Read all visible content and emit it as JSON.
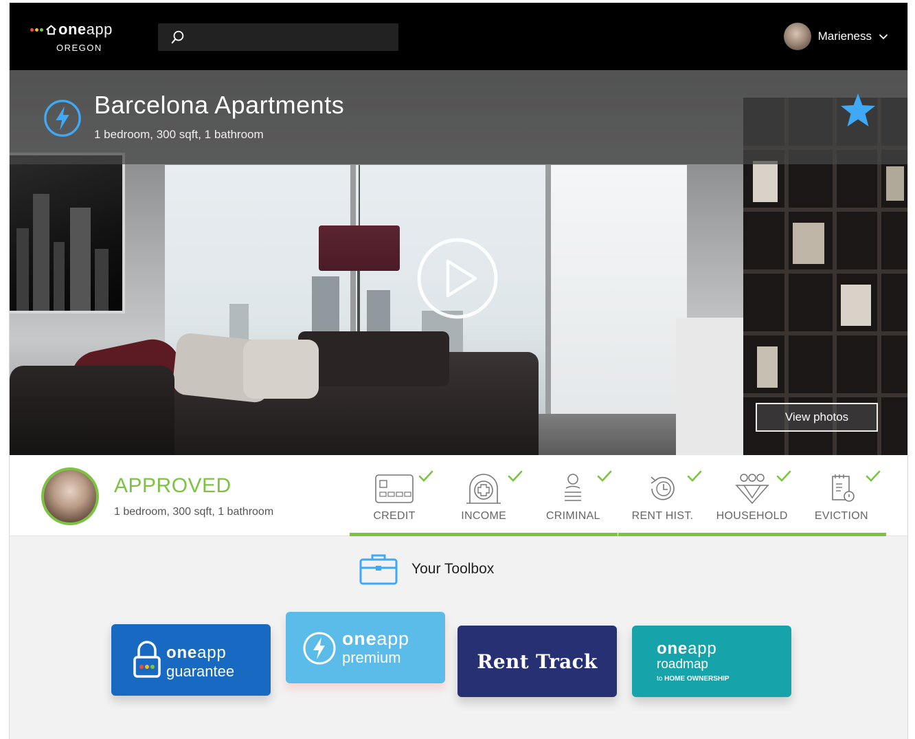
{
  "header": {
    "logo": {
      "one": "one",
      "app": "app",
      "region": "OREGON",
      "dot_colors": [
        "#f04e37",
        "#ffb81c",
        "#7cc344"
      ]
    },
    "search": {
      "placeholder": "",
      "icon": "search-icon"
    },
    "user": {
      "name": "Marieness",
      "icon": "chevron-down-icon"
    }
  },
  "listing": {
    "title": "Barcelona Apartments",
    "details": "1 bedroom, 300 sqft, 1 bathroom",
    "badge_icon": "lightning-icon",
    "favorite_icon": "star-icon",
    "play_icon": "play-icon",
    "view_photos_label": "View photos"
  },
  "status": {
    "title": "APPROVED",
    "details": "1 bedroom, 300 sqft, 1 bathroom",
    "accent": "#7cc344",
    "checks": [
      {
        "label": "CREDIT",
        "icon": "credit-card-icon"
      },
      {
        "label": "INCOME",
        "icon": "income-icon"
      },
      {
        "label": "CRIMINAL",
        "icon": "criminal-icon"
      },
      {
        "label": "RENT HIST.",
        "icon": "rent-history-icon"
      },
      {
        "label": "HOUSEHOLD",
        "icon": "household-icon"
      },
      {
        "label": "EVICTION",
        "icon": "eviction-icon"
      }
    ]
  },
  "toolbox": {
    "title": "Your Toolbox",
    "icon": "briefcase-icon",
    "cards": [
      {
        "one": "one",
        "app": "app",
        "sub": "guarantee",
        "color": "#1769c2",
        "icon": "lock-icon"
      },
      {
        "one": "one",
        "app": "app",
        "sub": "premium",
        "color": "#5bbcea",
        "icon": "lightning-icon"
      },
      {
        "title": "Rent Track",
        "color": "#283074"
      },
      {
        "one": "one",
        "app": "app",
        "sub": "roadmap",
        "tag_prefix": "to",
        "tag": "HOME OWNERSHIP",
        "color": "#17a3aa"
      }
    ]
  }
}
